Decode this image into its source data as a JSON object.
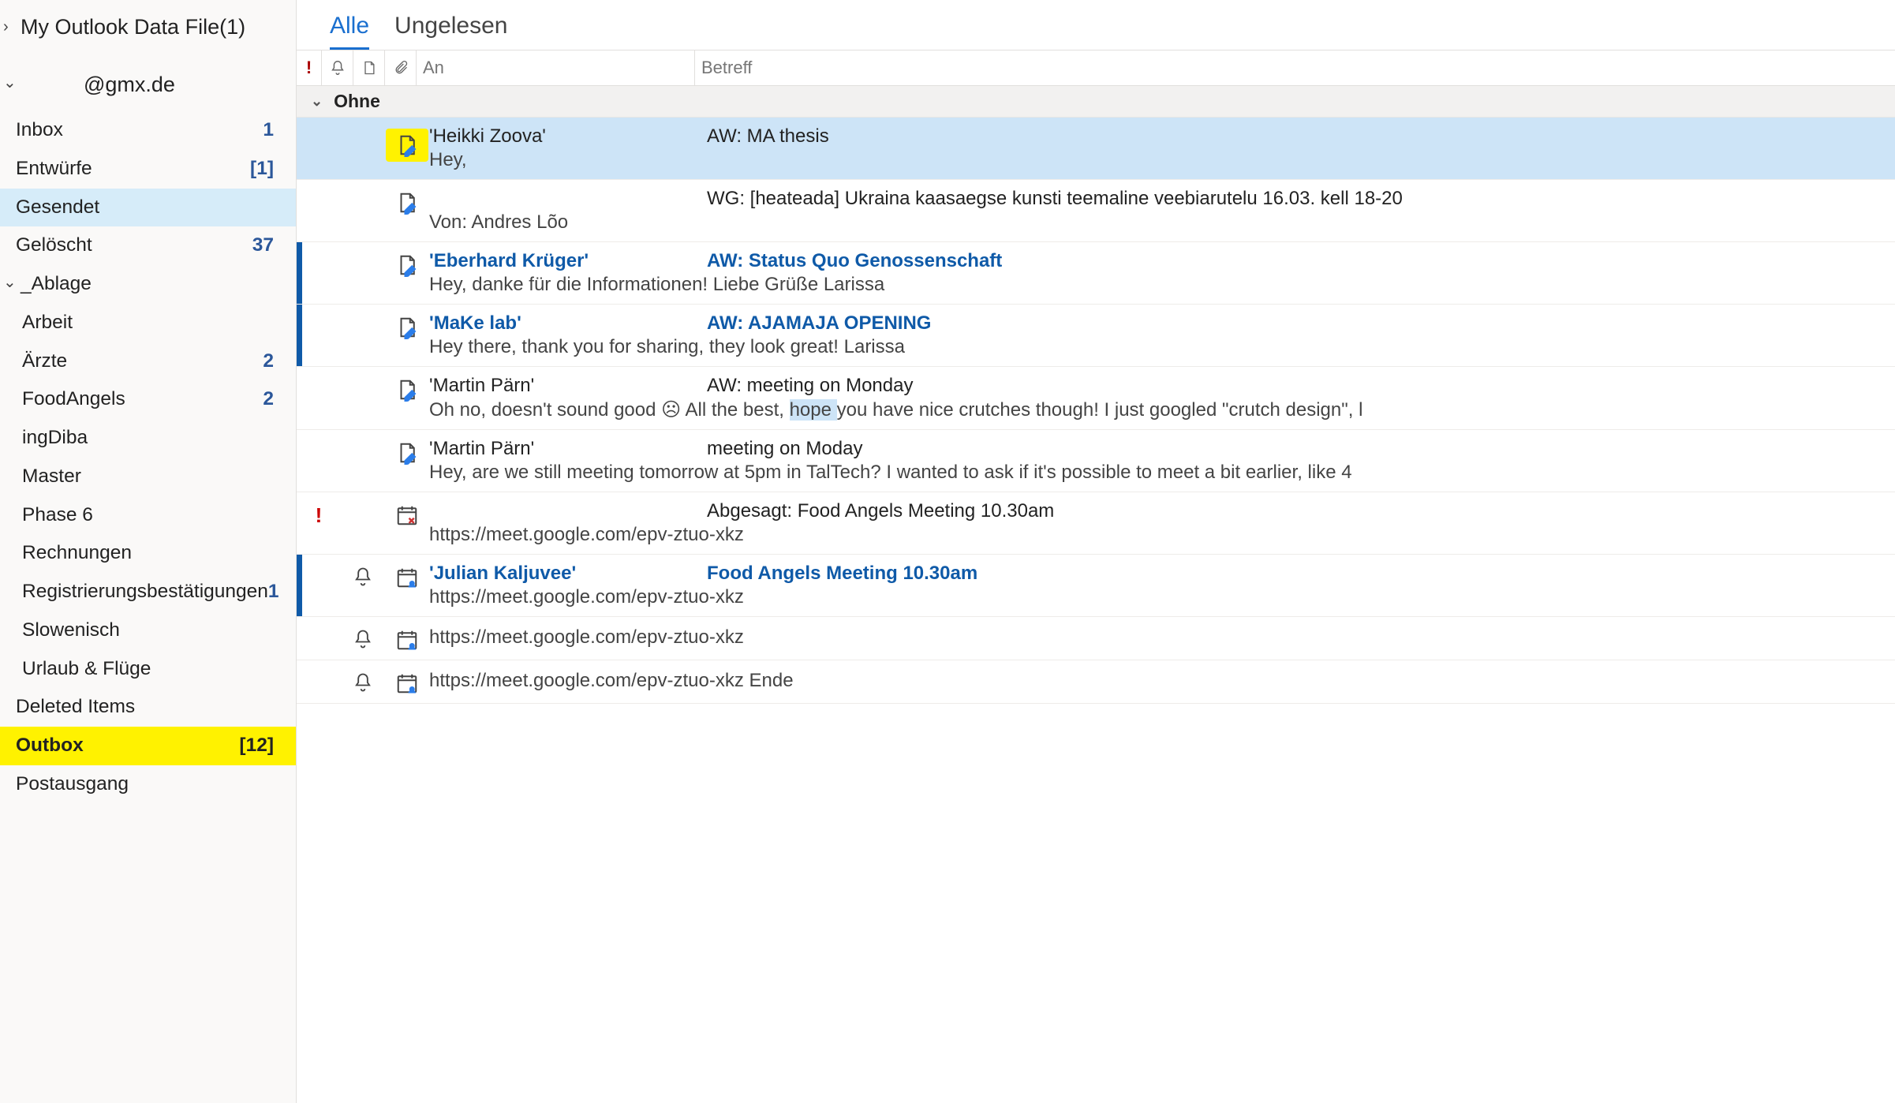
{
  "sidebar": {
    "data_file_label": "My Outlook Data File(1)",
    "account_label": "@gmx.de",
    "folders": [
      {
        "name": "Inbox",
        "count": "1"
      },
      {
        "name": "Entwürfe",
        "count": "[1]"
      },
      {
        "name": "Gesendet",
        "count": "",
        "selected": true
      },
      {
        "name": "Gelöscht",
        "count": "37"
      }
    ],
    "ablage_label": "_Ablage",
    "ablage_sub": [
      {
        "name": "Arbeit",
        "count": ""
      },
      {
        "name": "Ärzte",
        "count": "2"
      },
      {
        "name": "FoodAngels",
        "count": "2"
      },
      {
        "name": "ingDiba",
        "count": ""
      },
      {
        "name": "Master",
        "count": ""
      },
      {
        "name": "Phase 6",
        "count": ""
      },
      {
        "name": "Rechnungen",
        "count": ""
      },
      {
        "name": "Registrierungsbestätigungen",
        "count": "1"
      },
      {
        "name": "Slowenisch",
        "count": ""
      },
      {
        "name": "Urlaub & Flüge",
        "count": ""
      }
    ],
    "deleted_items_label": "Deleted Items",
    "outbox_label": "Outbox",
    "outbox_count": "[12]",
    "postausgang_label": "Postausgang"
  },
  "tabs": {
    "all": "Alle",
    "unread": "Ungelesen"
  },
  "headers": {
    "an": "An",
    "betreff": "Betreff"
  },
  "group_header": "Ohne",
  "messages": [
    {
      "to": "'Heikki Zoova'",
      "subject": "AW: MA thesis",
      "preview": "Hey,",
      "selected": true,
      "unread": false,
      "icon_a": "",
      "icon_b": "",
      "icon_c": "draft-highlight"
    },
    {
      "to": "",
      "subject": "WG: [heateada] Ukraina kaasaegse kunsti teemaline veebiarutelu 16.03. kell 18-20",
      "preview": "Von: Andres Lõo",
      "unread": false,
      "icon_a": "",
      "icon_b": "",
      "icon_c": "draft"
    },
    {
      "to": "'Eberhard Krüger'",
      "subject": "AW: Status Quo Genossenschaft",
      "preview": "Hey,  danke für die Informationen!   Liebe Grüße  Larissa",
      "unread": true,
      "icon_a": "",
      "icon_b": "",
      "icon_c": "draft"
    },
    {
      "to": "'MaKe lab'",
      "subject": "AW: AJAMAJA OPENING",
      "preview": "Hey there,  thank you for sharing, they look great!  Larissa",
      "unread": true,
      "icon_a": "",
      "icon_b": "",
      "icon_c": "draft"
    },
    {
      "to": "'Martin Pärn'",
      "subject": "AW: meeting on Monday",
      "preview_pre": "Oh no, doesn't sound good ☹ All the best, ",
      "preview_hl": "hope ",
      "preview_post": "you have nice crutches though! I just googled \"crutch design\", l",
      "unread": false,
      "icon_a": "",
      "icon_b": "",
      "icon_c": "draft"
    },
    {
      "to": "'Martin Pärn'",
      "subject": "meeting on Moday",
      "preview": "Hey,  are we still meeting tomorrow at 5pm in TalTech?  I wanted to ask if it's possible to meet a bit earlier, like 4",
      "unread": false,
      "icon_a": "",
      "icon_b": "",
      "icon_c": "draft"
    },
    {
      "to": "",
      "subject": "Abgesagt: Food Angels Meeting 10.30am",
      "preview": "https://meet.google.com/epv-ztuo-xkz <Ende>",
      "unread": false,
      "icon_a": "high",
      "icon_b": "",
      "icon_c": "cal-cancel"
    },
    {
      "to": "'Julian Kaljuvee'",
      "subject": "Food Angels Meeting 10.30am",
      "preview": "https://meet.google.com/epv-ztuo-xkz <Ende>",
      "unread": true,
      "icon_a": "",
      "icon_b": "bell",
      "icon_c": "cal-people"
    },
    {
      "to": "",
      "subject": "",
      "preview": "https://meet.google.com/epv-ztuo-xkz <Ende>",
      "unread": false,
      "icon_a": "",
      "icon_b": "bell",
      "icon_c": "cal-people"
    },
    {
      "to": "",
      "subject": "",
      "preview": "https://meet.google.com/epv-ztuo-xkz  Ende",
      "unread": false,
      "icon_a": "",
      "icon_b": "bell",
      "icon_c": "cal-people"
    }
  ],
  "icons": {
    "flag_header": "!",
    "bell_header": "🔔",
    "doc_header": "📄",
    "clip_header": "📎"
  }
}
